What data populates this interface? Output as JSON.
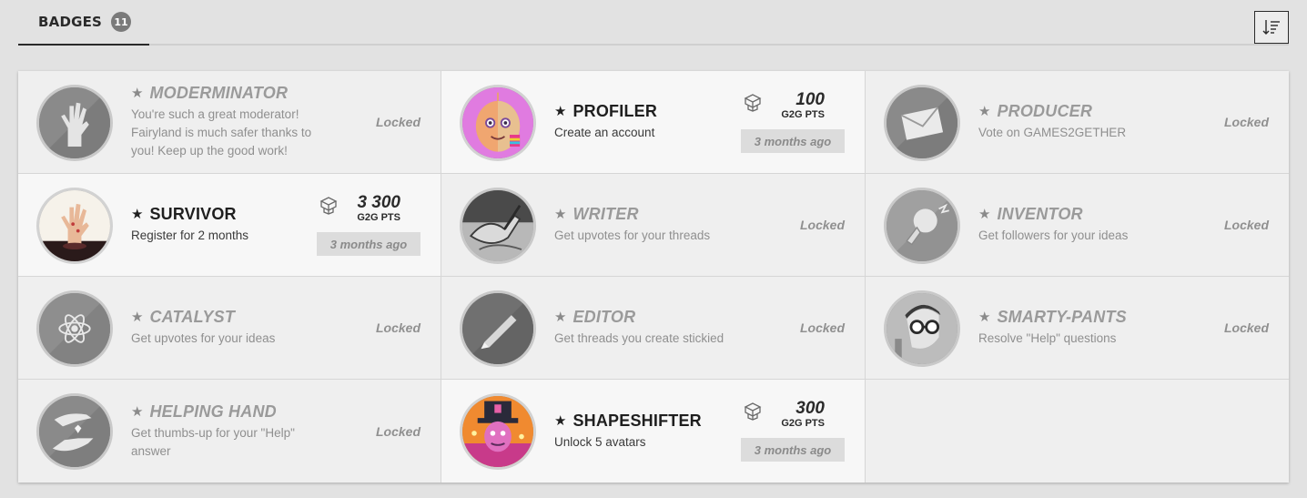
{
  "tabs": {
    "badges_label": "BADGES",
    "badges_count": "11"
  },
  "sort": {
    "icon": "sort-descending-icon"
  },
  "colors": {
    "locked_text": "#9a9a9a",
    "unlocked_text": "#1f1f1f",
    "background": "#e2e2e2"
  },
  "badges": [
    {
      "title": "MODERMINATOR",
      "desc": "You're such a great moderator! Fairyland is much safer thanks to you! Keep up the good work!",
      "status": "Locked",
      "icon": "zombie-hand-icon"
    },
    {
      "title": "PROFILER",
      "desc": "Create an account",
      "points": "100",
      "points_unit": "G2G PTS",
      "time": "3 months ago",
      "icon": "baby-avatar-icon"
    },
    {
      "title": "PRODUCER",
      "desc": "Vote on GAMES2GETHER",
      "status": "Locked",
      "icon": "envelope-icon"
    },
    {
      "title": "SURVIVOR",
      "desc": "Register for 2 months",
      "points": "3 300",
      "points_unit": "G2G PTS",
      "time": "3 months ago",
      "icon": "zombie-hand-icon"
    },
    {
      "title": "WRITER",
      "desc": "Get upvotes for your threads",
      "status": "Locked",
      "icon": "writing-hand-icon"
    },
    {
      "title": "INVENTOR",
      "desc": "Get followers for your ideas",
      "status": "Locked",
      "icon": "lightbulb-icon"
    },
    {
      "title": "CATALYST",
      "desc": "Get upvotes for your ideas",
      "status": "Locked",
      "icon": "atom-icon"
    },
    {
      "title": "EDITOR",
      "desc": "Get threads you create stickied",
      "status": "Locked",
      "icon": "pencil-icon"
    },
    {
      "title": "SMARTY-PANTS",
      "desc": "Resolve \"Help\" questions",
      "status": "Locked",
      "icon": "glasses-man-icon"
    },
    {
      "title": "HELPING HAND",
      "desc": "Get thumbs-up for your \"Help\" answer",
      "status": "Locked",
      "icon": "helping-hands-icon"
    },
    {
      "title": "SHAPESHIFTER",
      "desc": "Unlock 5 avatars",
      "points": "300",
      "points_unit": "G2G PTS",
      "time": "3 months ago",
      "icon": "magician-avatar-icon"
    }
  ]
}
